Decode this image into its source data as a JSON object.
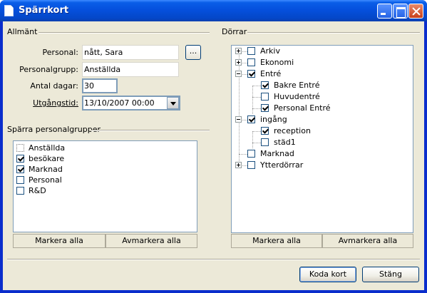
{
  "window": {
    "title": "Spärrkort"
  },
  "general": {
    "group_label": "Allmänt",
    "personal_label": "Personal:",
    "personal_value": "nått, Sara",
    "browse_label": "...",
    "group_field_label": "Personalgrupp:",
    "group_field_value": "Anställda",
    "days_label": "Antal dagar:",
    "days_value": "30",
    "expiry_label": "Utgångstid:",
    "expiry_value": "13/10/2007 00:00"
  },
  "block_groups": {
    "group_label": "Spärra personalgrupper",
    "items": [
      {
        "label": "Anställda",
        "checked": false,
        "focused": true
      },
      {
        "label": "besökare",
        "checked": true
      },
      {
        "label": "Marknad",
        "checked": true
      },
      {
        "label": "Personal",
        "checked": false
      },
      {
        "label": "R&D",
        "checked": false
      }
    ],
    "select_all": "Markera alla",
    "deselect_all": "Avmarkera alla"
  },
  "doors": {
    "group_label": "Dörrar",
    "nodes": [
      {
        "label": "Arkiv",
        "checked": false,
        "expander": "plus"
      },
      {
        "label": "Ekonomi",
        "checked": false,
        "expander": "plus"
      },
      {
        "label": "Entré",
        "checked": true,
        "expander": "minus"
      },
      {
        "label": "Bakre Entré",
        "checked": true
      },
      {
        "label": "Huvudentré",
        "checked": false
      },
      {
        "label": "Personal Entré",
        "checked": true
      },
      {
        "label": "ingång",
        "checked": true,
        "expander": "minus"
      },
      {
        "label": "reception",
        "checked": true
      },
      {
        "label": "städ1",
        "checked": false
      },
      {
        "label": "Marknad",
        "checked": false
      },
      {
        "label": "Ytterdörrar",
        "checked": false,
        "expander": "plus"
      }
    ],
    "select_all": "Markera alla",
    "deselect_all": "Avmarkera alla"
  },
  "actions": {
    "ok": "Koda kort",
    "close": "Stäng"
  }
}
